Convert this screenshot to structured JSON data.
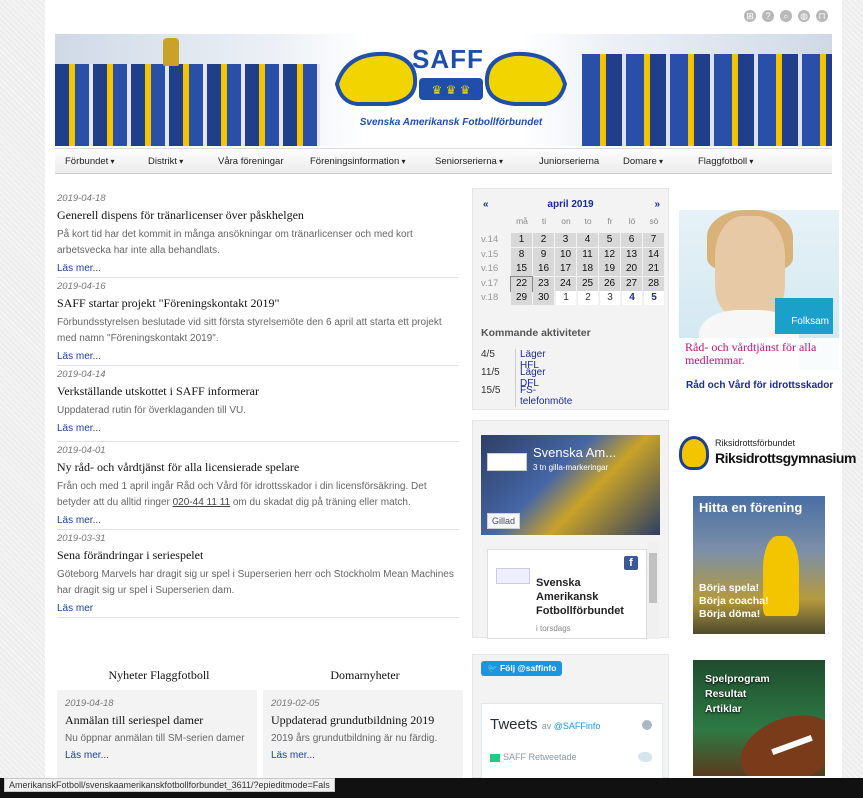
{
  "nav": {
    "items": [
      {
        "label": "Förbundet",
        "dropdown": true
      },
      {
        "label": "Distrikt",
        "dropdown": true
      },
      {
        "label": "Våra föreningar",
        "dropdown": false
      },
      {
        "label": "Föreningsinformation",
        "dropdown": true
      },
      {
        "label": "Seniorserierna",
        "dropdown": true
      },
      {
        "label": "Juniorserierna",
        "dropdown": false
      },
      {
        "label": "Domare",
        "dropdown": true
      },
      {
        "label": "Flaggfotboll",
        "dropdown": true
      }
    ]
  },
  "header": {
    "logo_mark": "SAFF",
    "logo_text": "Svenska Amerikansk Fotbollförbundet",
    "top_icons": [
      "sitemap-icon",
      "help-icon",
      "search-icon",
      "globe-icon",
      "unlock-icon"
    ]
  },
  "news": {
    "items": [
      {
        "date": "2019-04-18",
        "title": "Generell dispens för tränarlicenser över påskhelgen",
        "text": "På kort tid har det kommit in många ansökningar om tränarlicenser och med kort arbetsvecka har inte alla behandlats.",
        "more": "Läs mer..."
      },
      {
        "date": "2019-04-16",
        "title": "SAFF startar projekt \"Föreningskontakt 2019\"",
        "text": "Förbundsstyrelsen beslutade vid sitt första styrelsemöte den 6 april att starta ett projekt med namn \"Föreningskontakt 2019\".",
        "more": "Läs mer..."
      },
      {
        "date": "2019-04-14",
        "title": "Verkställande utskottet i SAFF informerar",
        "text": "Uppdaterad rutin för överklaganden till VU.",
        "more": "Läs mer..."
      },
      {
        "date": "2019-04-01",
        "title": "Ny råd- och vårdtjänst för alla licensierade spelare",
        "text_before": "Från och med 1 april ingår Råd och Vård för idrottsskador i din licensförsäkring. Det betyder att du alltid ringer ",
        "phone": "020-44 11 11",
        "text_after": " om du skadat dig på träning eller match.",
        "more": "Läs mer..."
      },
      {
        "date": "2019-03-31",
        "title": "Sena förändringar i seriespelet",
        "text": "Göteborg Marvels har dragit sig ur spel i Superserien herr och Stockholm Mean Machines har dragit sig ur spel i Superserien dam.",
        "more": "Läs mer"
      }
    ]
  },
  "calendar": {
    "prev": "«",
    "next": "»",
    "title": "april 2019",
    "weekdays": [
      "må",
      "ti",
      "on",
      "to",
      "fr",
      "lö",
      "sö"
    ],
    "weeks": [
      {
        "week": "v.14",
        "days": [
          "1",
          "2",
          "3",
          "4",
          "5",
          "6",
          "7"
        ]
      },
      {
        "week": "v.15",
        "days": [
          "8",
          "9",
          "10",
          "11",
          "12",
          "13",
          "14"
        ]
      },
      {
        "week": "v.16",
        "days": [
          "15",
          "16",
          "17",
          "18",
          "19",
          "20",
          "21"
        ]
      },
      {
        "week": "v.17",
        "days": [
          "22",
          "23",
          "24",
          "25",
          "26",
          "27",
          "28"
        ]
      },
      {
        "week": "v.18",
        "days": [
          "29",
          "30",
          "1",
          "2",
          "3",
          "4",
          "5"
        ]
      }
    ],
    "today": "22"
  },
  "upcoming": {
    "title": "Kommande aktiviteter",
    "items": [
      {
        "date": "4/5",
        "label": "Läger HFL"
      },
      {
        "date": "11/5",
        "label": "Läger DFL"
      },
      {
        "date": "15/5",
        "label": "FS-telefonmöte"
      }
    ]
  },
  "facebook": {
    "page_name": "Svenska Am...",
    "likes": "3 tn gilla-markeringar",
    "liked_label": "Gillad",
    "post_name": "Svenska Amerikansk Fotbollförbundet",
    "post_time": "i torsdags"
  },
  "ads": {
    "folksam_brand": "Folksam",
    "folksam_caption": "Råd- och vårdtjänst för alla medlemmar.",
    "folksam_link": "Råd och Vård för idrottsskador",
    "rf_small": "Riksidrottsförbundet",
    "rf_big": "Riksidrottsgymnasium",
    "forening_head": "Hitta en förening",
    "forening_lines": [
      "Börja spela!",
      "Börja coacha!",
      "Börja döma!"
    ],
    "spel_lines": [
      "Spelprogram",
      "Resultat",
      "Artiklar"
    ]
  },
  "bottom": {
    "flag_title": "Nyheter Flaggfotboll",
    "flag_date": "2019-04-18",
    "flag_item_title": "Anmälan till seriespel damer",
    "flag_item_text": "Nu öppnar anmälan till SM-serien damer",
    "flag_more": "Läs mer...",
    "ref_title": "Domarnyheter",
    "ref_date": "2019-02-05",
    "ref_item_title": "Uppdaterad grundutbildning 2019",
    "ref_item_text": "2019 års grundutbildning är nu färdig.",
    "ref_more": "Läs mer..."
  },
  "twitter": {
    "follow": "Följ @saffinfo",
    "title": "Tweets",
    "by": "av",
    "handle": "@SAFFinfo",
    "retweeted": "SAFF Retweetade"
  },
  "status": {
    "url": "AmerikanskFotboll/svenskaamerikanskfotbollforbundet_3611/?epieditmode=Fals"
  },
  "colors": {
    "link": "#1b3f9e",
    "calendar_title": "#1b2c8f",
    "folksam_caption": "#c0147a",
    "twitter": "#1b95e0"
  }
}
